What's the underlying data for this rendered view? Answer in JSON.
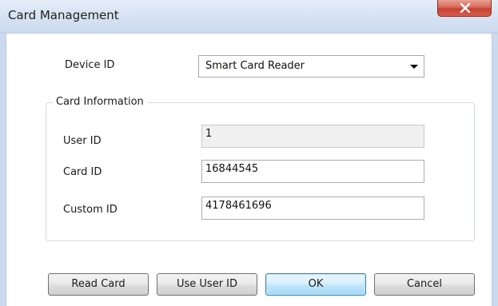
{
  "window": {
    "title": "Card Management",
    "close_glyph": "X"
  },
  "device": {
    "label": "Device ID",
    "selected": "Smart Card Reader"
  },
  "card_info": {
    "group_label": "Card Information",
    "user_id_label": "User ID",
    "user_id_value": "1",
    "card_id_label": "Card ID",
    "card_id_value": "16844545",
    "custom_id_label": "Custom ID",
    "custom_id_value": "4178461696"
  },
  "buttons": {
    "read_card": "Read Card",
    "use_user_id": "Use User ID",
    "ok": "OK",
    "cancel": "Cancel"
  },
  "colors": {
    "title_bar": "#d7e3f3",
    "close_button": "#c6402f",
    "default_button_border": "#3c7fb1"
  }
}
